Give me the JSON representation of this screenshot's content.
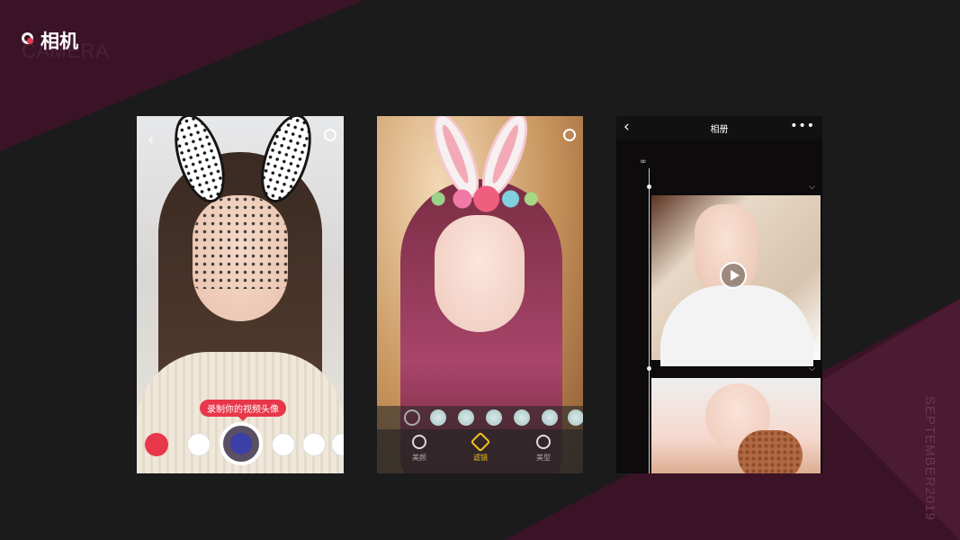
{
  "header": {
    "title": "相机",
    "subtitle": "CAMERA"
  },
  "side_text": "SEPTEMBER2019",
  "colors": {
    "background": "#1b1b1c",
    "accent_purple": "#3b1326",
    "accent_red": "#e8374a",
    "filter_active": "#f2c318"
  },
  "phone1": {
    "record_prompt": "录制你的视频头像",
    "icons": [
      "back-icon",
      "flip-camera-icon",
      "sticker-icons",
      "shutter-button"
    ]
  },
  "phone2": {
    "tools": [
      {
        "label": "美颜"
      },
      {
        "label": "滤镜"
      },
      {
        "label": "美型"
      }
    ],
    "active_tool": "滤镜"
  },
  "phone3": {
    "nav_title": "相册",
    "back_glyph": "‹",
    "more_glyph": "•••"
  }
}
